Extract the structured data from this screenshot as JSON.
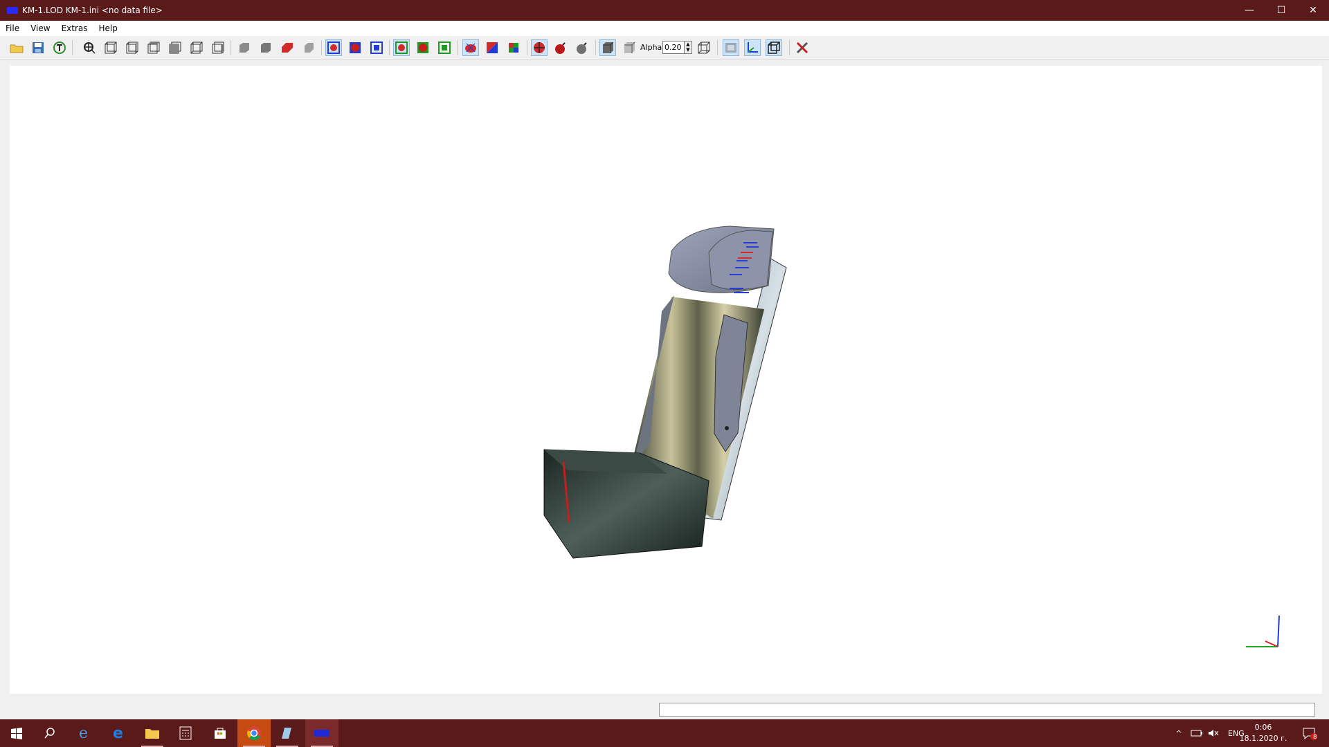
{
  "window": {
    "title": "KM-1.LOD  KM-1.ini  <no data file>",
    "controls": [
      "—",
      "☐",
      "✕"
    ]
  },
  "menu": [
    "File",
    "View",
    "Extras",
    "Help"
  ],
  "toolbar": {
    "alpha_label": "Alpha:",
    "alpha_value": "0.20"
  },
  "taskbar": {
    "items": [
      "start",
      "search",
      "internet-explorer",
      "edge",
      "file-explorer",
      "calculator",
      "store",
      "chrome",
      "notepad",
      "lod-viewer"
    ],
    "tray": {
      "language": "ENG",
      "time": "0:06",
      "date": "18.1.2020 г.",
      "notifications": "8"
    }
  },
  "colors": {
    "titlebar": "#5a1a1a",
    "chrome_taskbar_highlight": "#c64b12"
  }
}
